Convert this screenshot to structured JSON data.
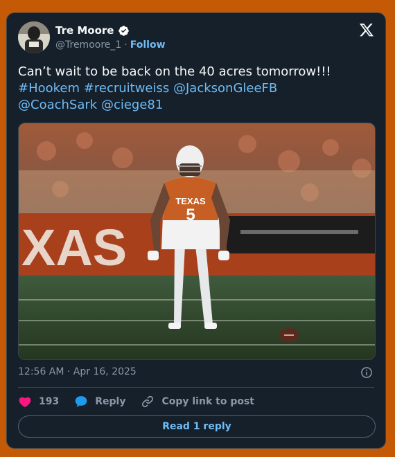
{
  "author": {
    "name": "Tre Moore",
    "handle": "@Tremoore_1",
    "separator": "·",
    "follow_label": "Follow"
  },
  "tweet": {
    "text": "Can’t wait to be back on the 40 acres tomorrow!!!",
    "tags": [
      "#Hookem",
      "#recruitweiss",
      "@JacksonGleeFB",
      "@CoachSark",
      "@ciege81"
    ]
  },
  "media": {
    "jersey_word": "TEXAS",
    "jersey_number": "5",
    "wall_text": "XAS"
  },
  "timestamp": "12:56 AM · Apr 16, 2025",
  "actions": {
    "like_count": "193",
    "reply_label": "Reply",
    "copy_label": "Copy link to post"
  },
  "read_replies_label": "Read 1 reply",
  "colors": {
    "background": "#c45a06",
    "card": "#15202b",
    "link": "#6fbcf6",
    "like": "#f91880",
    "reply_icon": "#1d9bf0"
  },
  "icons": [
    "verified-badge-icon",
    "x-logo-icon",
    "info-icon",
    "heart-icon",
    "reply-bubble-icon",
    "link-icon"
  ]
}
